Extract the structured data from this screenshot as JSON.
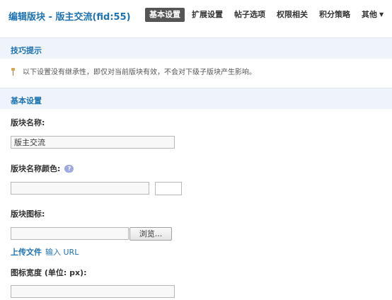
{
  "header": {
    "title": "编辑版块 - 版主交流(fid:55)",
    "tabs": [
      {
        "label": "基本设置"
      },
      {
        "label": "扩展设置"
      },
      {
        "label": "帖子选项"
      },
      {
        "label": "权限相关"
      },
      {
        "label": "积分策略"
      },
      {
        "label": "其他"
      }
    ]
  },
  "tips": {
    "title": "技巧提示",
    "text": "以下设置没有继承性，即仅对当前版块有效，不会对下级子版块产生影响。"
  },
  "basic": {
    "title": "基本设置",
    "name_label": "版块名称:",
    "name_value": "版主交流",
    "color_label": "版块名称颜色:",
    "color_value": "",
    "icon_label": "版块图标:",
    "icon_value": "",
    "browse_label": "浏览...",
    "upload_label": "上传文件",
    "input_label": "输入",
    "url_label": "URL",
    "width_label": "图标宽度 (单位: px):",
    "width_value": ""
  },
  "colors": {
    "accent": "#1d72b3",
    "active_tab": "#555555",
    "section_bg": "#eef4fa"
  }
}
